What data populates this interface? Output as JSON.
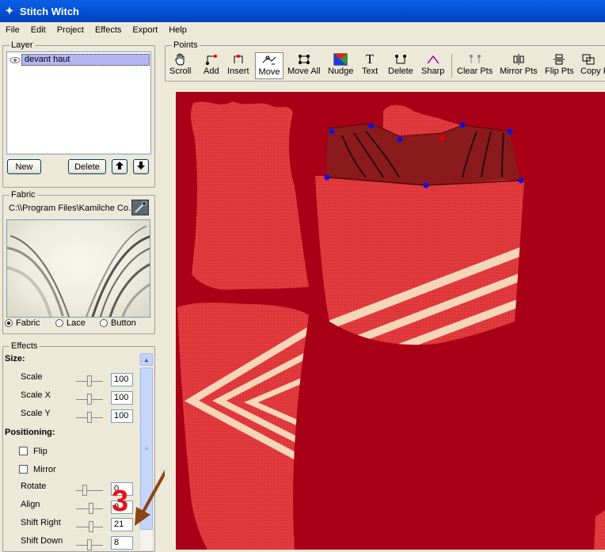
{
  "window": {
    "title": "Stitch Witch"
  },
  "menu": [
    "File",
    "Edit",
    "Project",
    "Effects",
    "Export",
    "Help"
  ],
  "layer": {
    "legend": "Layer",
    "items": [
      {
        "name": "devant haut",
        "selected": true
      }
    ],
    "new_label": "New",
    "delete_label": "Delete"
  },
  "fabric": {
    "legend": "Fabric",
    "path": "C:\\\\Program  Files\\Kamilche  Co...ng",
    "options": [
      "Fabric",
      "Lace",
      "Button"
    ],
    "selected": "Fabric"
  },
  "effects": {
    "legend": "Effects",
    "size_label": "Size:",
    "scale_label": "Scale",
    "scale_value": "100",
    "scalex_label": "Scale X",
    "scalex_value": "100",
    "scaley_label": "Scale Y",
    "scaley_value": "100",
    "positioning_label": "Positioning:",
    "flip_label": "Flip",
    "mirror_label": "Mirror",
    "rotate_label": "Rotate",
    "rotate_value": "0",
    "align_label": "Align",
    "align_value": "0",
    "shift_right_label": "Shift Right",
    "shift_right_value": "21",
    "shift_down_label": "Shift Down",
    "shift_down_value": "8"
  },
  "annotation": {
    "number": "3",
    "arrow_color": "#8b4513",
    "number_color": "#e8121a"
  },
  "points": {
    "legend": "Points",
    "tools": [
      "Scroll",
      "Add",
      "Insert",
      "Move",
      "Move All",
      "Nudge",
      "Text",
      "Delete",
      "Sharp",
      "Clear Pts",
      "Mirror Pts",
      "Flip Pts",
      "Copy Pts"
    ],
    "active_tool": "Move"
  },
  "colors": {
    "canvas_bg": "#a80016",
    "fabric_red": "#e03a3c",
    "stripe": "#f6d6b8",
    "point": "#1010e0",
    "selected_point": "#e00000"
  }
}
